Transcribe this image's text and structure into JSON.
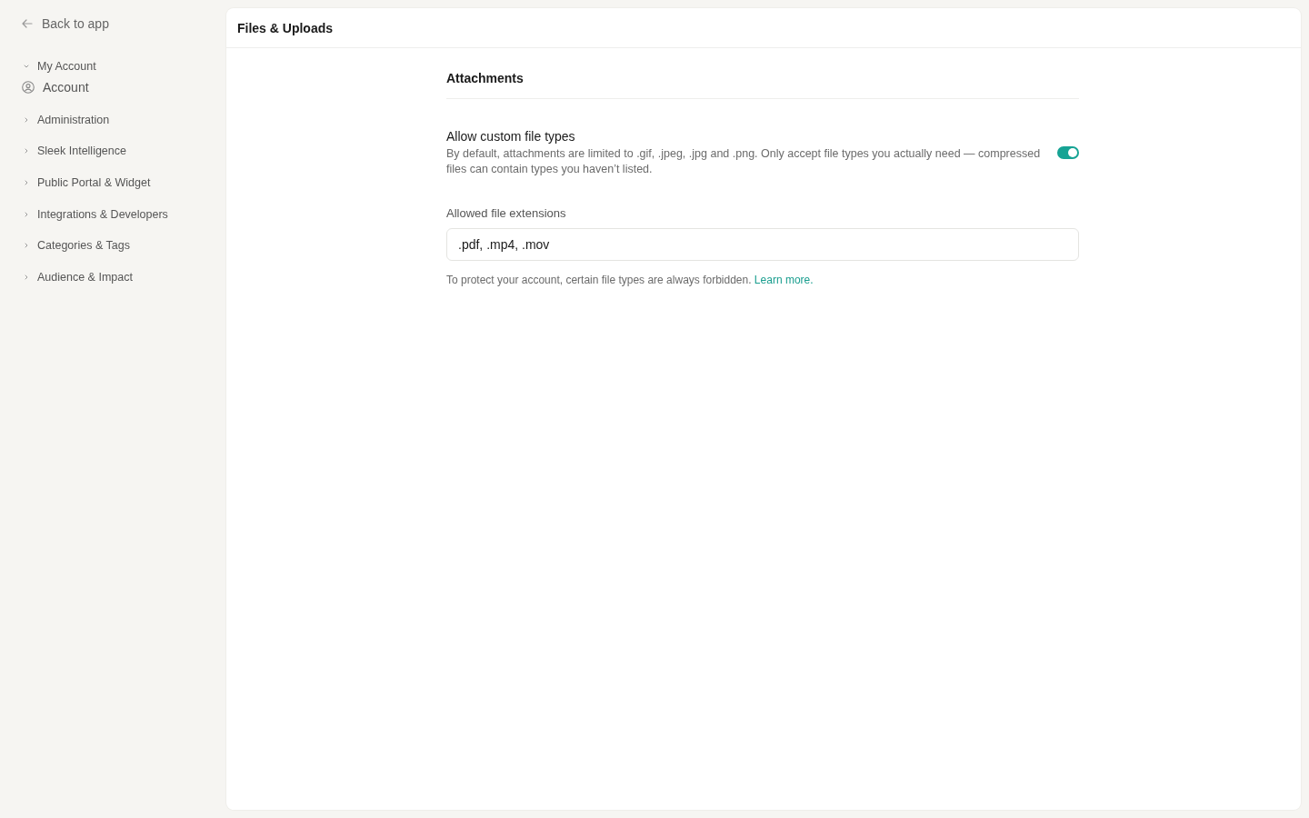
{
  "sidebar": {
    "back_link": "Back to app",
    "groups": [
      {
        "label": "My Account",
        "expanded": true,
        "children": [
          {
            "label": "Account"
          }
        ]
      },
      {
        "label": "Administration",
        "expanded": false
      },
      {
        "label": "Sleek Intelligence",
        "expanded": false
      },
      {
        "label": "Public Portal & Widget",
        "expanded": false
      },
      {
        "label": "Integrations & Developers",
        "expanded": false
      },
      {
        "label": "Categories & Tags",
        "expanded": false
      },
      {
        "label": "Audience & Impact",
        "expanded": false
      }
    ]
  },
  "page": {
    "title": "Files & Uploads"
  },
  "section": {
    "title": "Attachments",
    "toggle_setting": {
      "label": "Allow custom file types",
      "description": "By default, attachments are limited to .gif, .jpeg, .jpg and .png. Only accept file types you actually need — compressed files can contain types you haven’t listed.",
      "on": true
    },
    "extensions_field": {
      "label": "Allowed file extensions",
      "value": ".pdf, .mp4, .mov",
      "help": "To protect your account, certain file types are always forbidden.",
      "help_link": "Learn more."
    }
  }
}
